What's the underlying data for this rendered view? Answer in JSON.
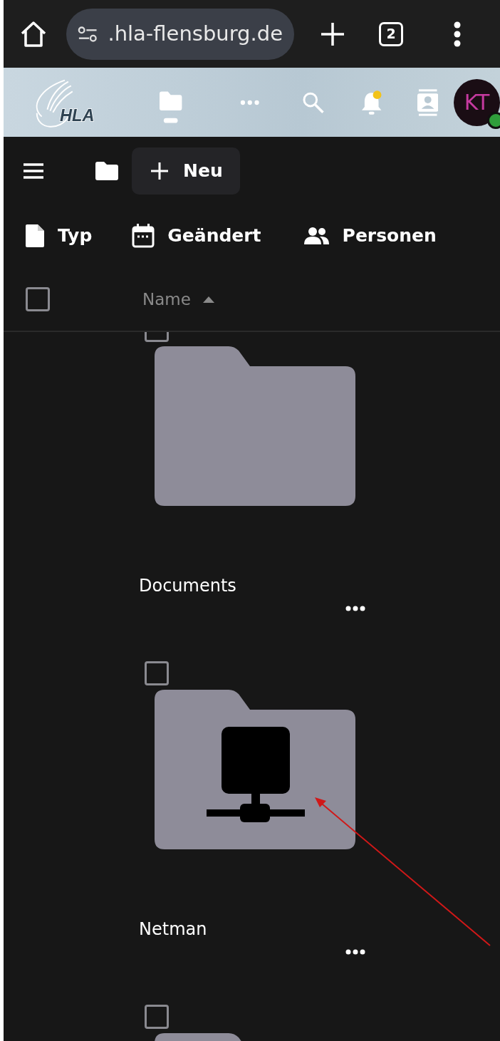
{
  "browser": {
    "url": ".hla-flensburg.de",
    "tab_count": "2"
  },
  "app_header": {
    "logo_text": "HLA",
    "avatar_initials": "KT",
    "notification_unread": true,
    "user_online": true
  },
  "toolbar": {
    "new_button": "Neu"
  },
  "filters": [
    {
      "kind": "type",
      "label": "Typ"
    },
    {
      "kind": "modified",
      "label": "Geändert"
    },
    {
      "kind": "people",
      "label": "Personen"
    }
  ],
  "table": {
    "select_all_checked": false,
    "name_column": "Name",
    "sort_ascending": true
  },
  "files": [
    {
      "kind": "folder",
      "name": "Documents",
      "checked": false
    },
    {
      "kind": "network_folder",
      "name": "Netman",
      "checked": false
    },
    {
      "kind": "folder",
      "checked": false
    }
  ],
  "annotation": {
    "kind": "arrow",
    "color": "#d01818"
  }
}
